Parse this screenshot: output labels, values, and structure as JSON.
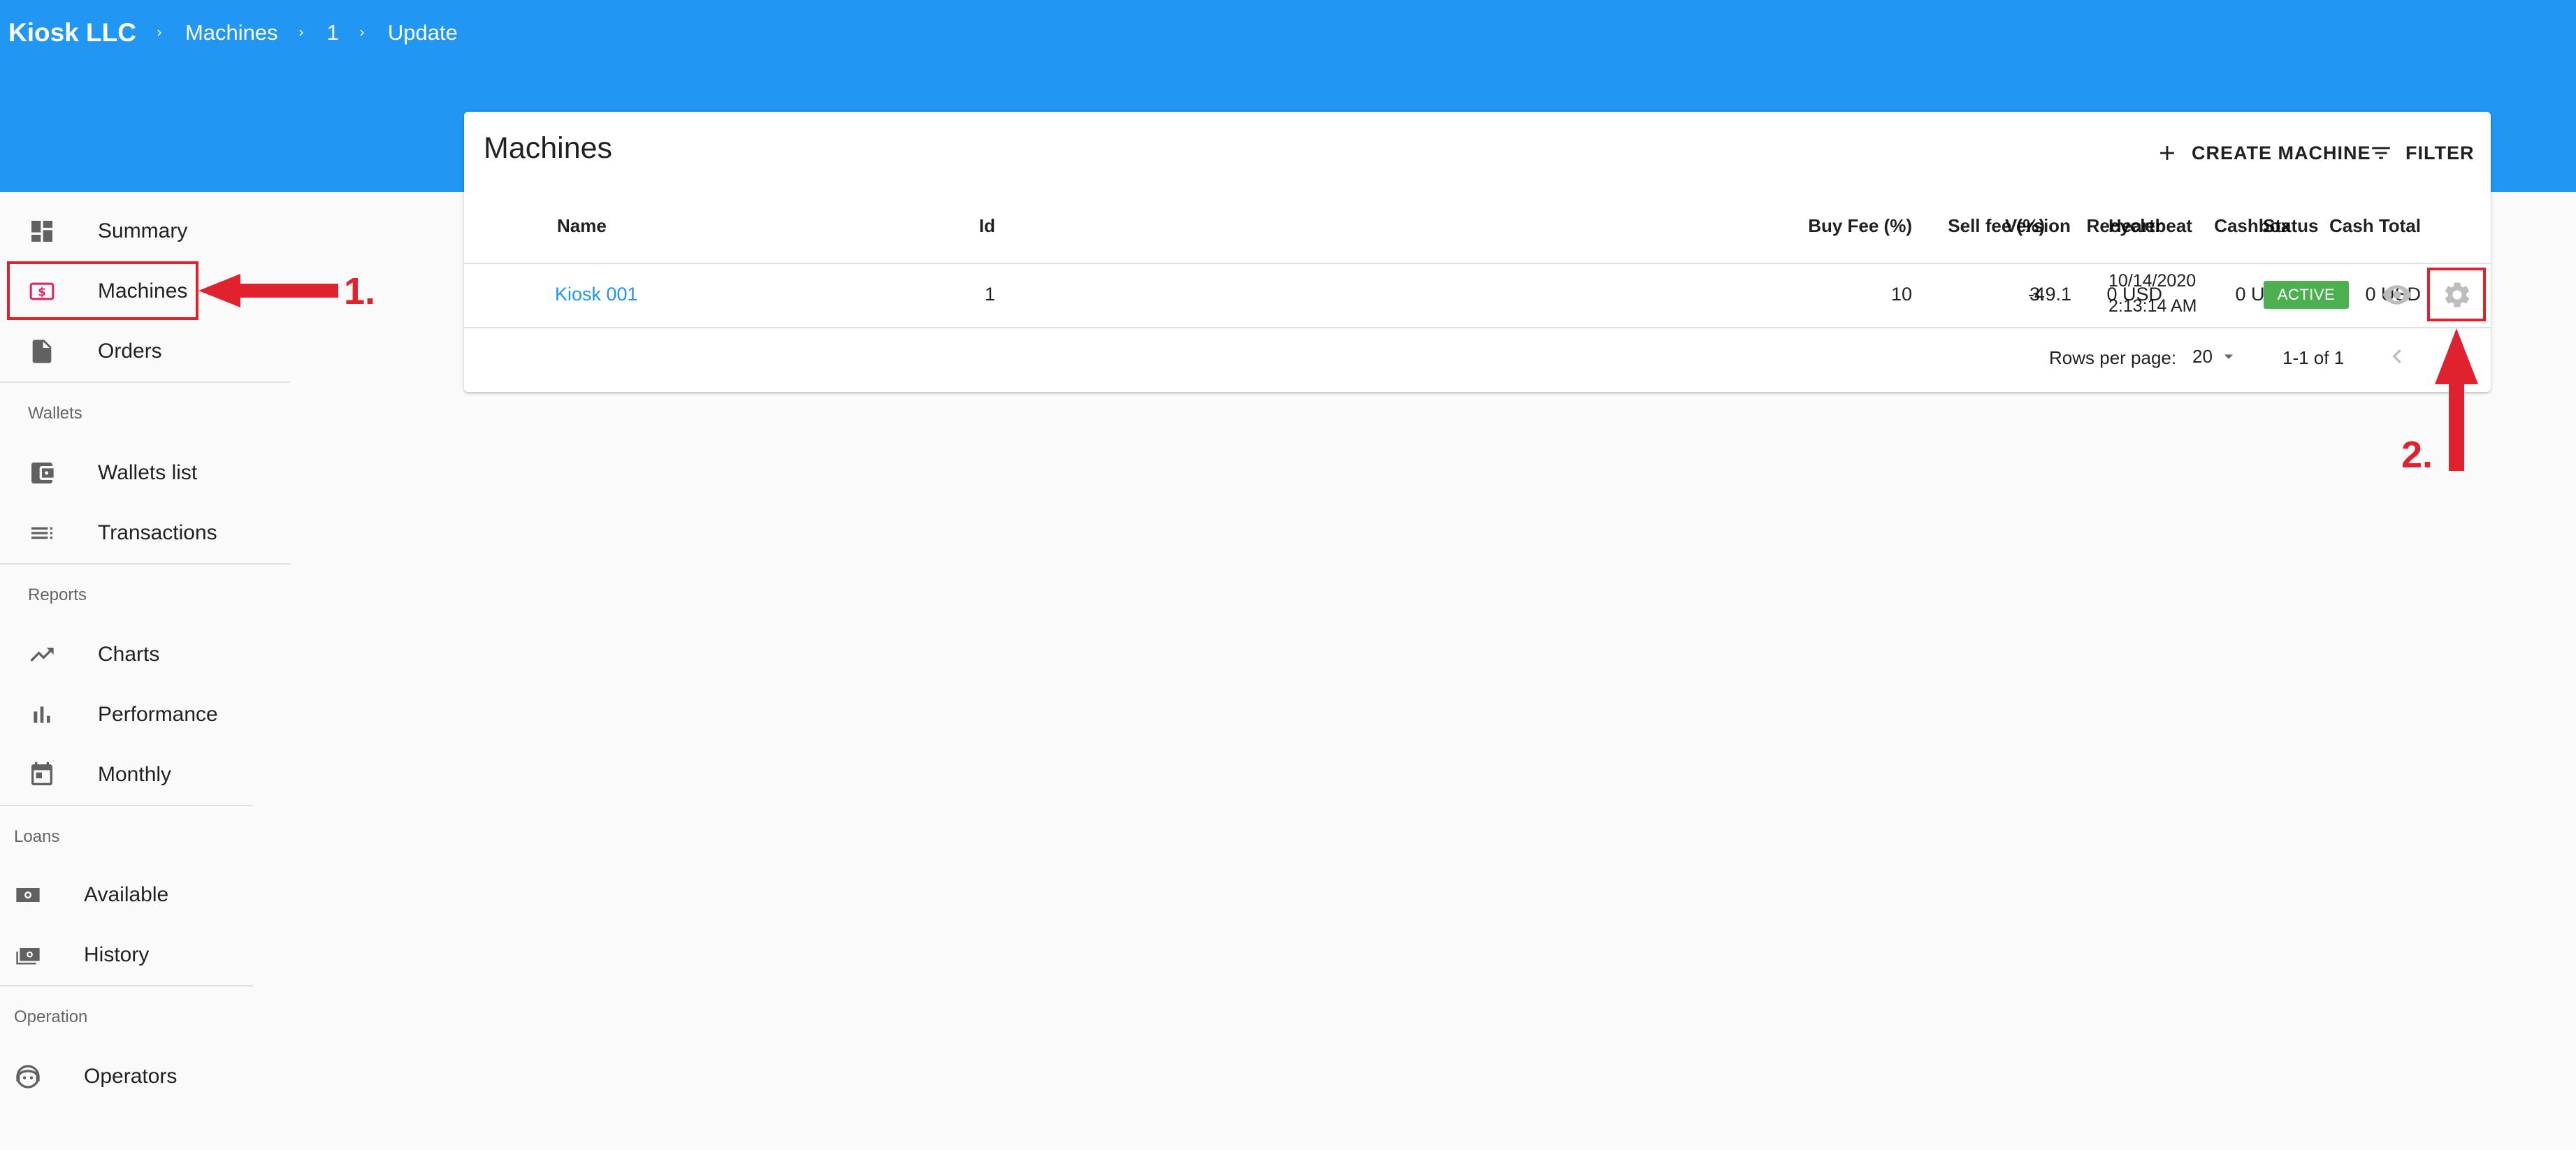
{
  "breadcrumb": [
    "Kiosk LLC",
    "Machines",
    "1",
    "Update"
  ],
  "sidebar": {
    "items_top": [
      {
        "label": "Summary",
        "icon": "dashboard-icon"
      },
      {
        "label": "Machines",
        "icon": "machine-money-icon",
        "accent": "#e91e63"
      },
      {
        "label": "Orders",
        "icon": "file-icon"
      }
    ],
    "sections": [
      {
        "label": "Wallets",
        "items": [
          {
            "label": "Wallets list",
            "icon": "wallet-icon"
          },
          {
            "label": "Transactions",
            "icon": "list-icon"
          }
        ]
      },
      {
        "label": "Reports",
        "items": [
          {
            "label": "Charts",
            "icon": "trending-up-icon"
          },
          {
            "label": "Performance",
            "icon": "bar-chart-icon"
          },
          {
            "label": "Monthly",
            "icon": "calendar-icon"
          }
        ]
      },
      {
        "label": "Loans",
        "items": [
          {
            "label": "Available",
            "icon": "money-icon"
          },
          {
            "label": "History",
            "icon": "money-stack-icon"
          }
        ]
      },
      {
        "label": "Operation",
        "items": [
          {
            "label": "Operators",
            "icon": "operator-face-icon"
          }
        ]
      }
    ]
  },
  "card": {
    "title": "Machines",
    "create_label": "CREATE MACHINE",
    "filter_label": "FILTER"
  },
  "table": {
    "columns": [
      "Id",
      "Name",
      "Buy Fee (%)",
      "Sell fee (%)",
      "Recycler",
      "Cashbox",
      "Cash Total",
      "Version",
      "Heartbeat",
      "Status"
    ],
    "rows": [
      {
        "id": "1",
        "name": "Kiosk 001",
        "buy_fee": "10",
        "sell_fee": "-4",
        "recycler": "0 USD",
        "cashbox": "0 USD",
        "cash_total": "0 USD",
        "version": "3.9.1",
        "heartbeat_date": "10/14/2020",
        "heartbeat_time": "2:13:14 AM",
        "status": "ACTIVE"
      }
    ],
    "rows_per_page_label": "Rows per page:",
    "rows_per_page_value": "20",
    "range_label": "1-1 of 1"
  },
  "annotations": {
    "step1": "1.",
    "step2": "2."
  },
  "colors": {
    "appbar": "#2196f3",
    "active_badge": "#4caf50",
    "annotation": "#e0212e",
    "link": "#2196f3"
  }
}
